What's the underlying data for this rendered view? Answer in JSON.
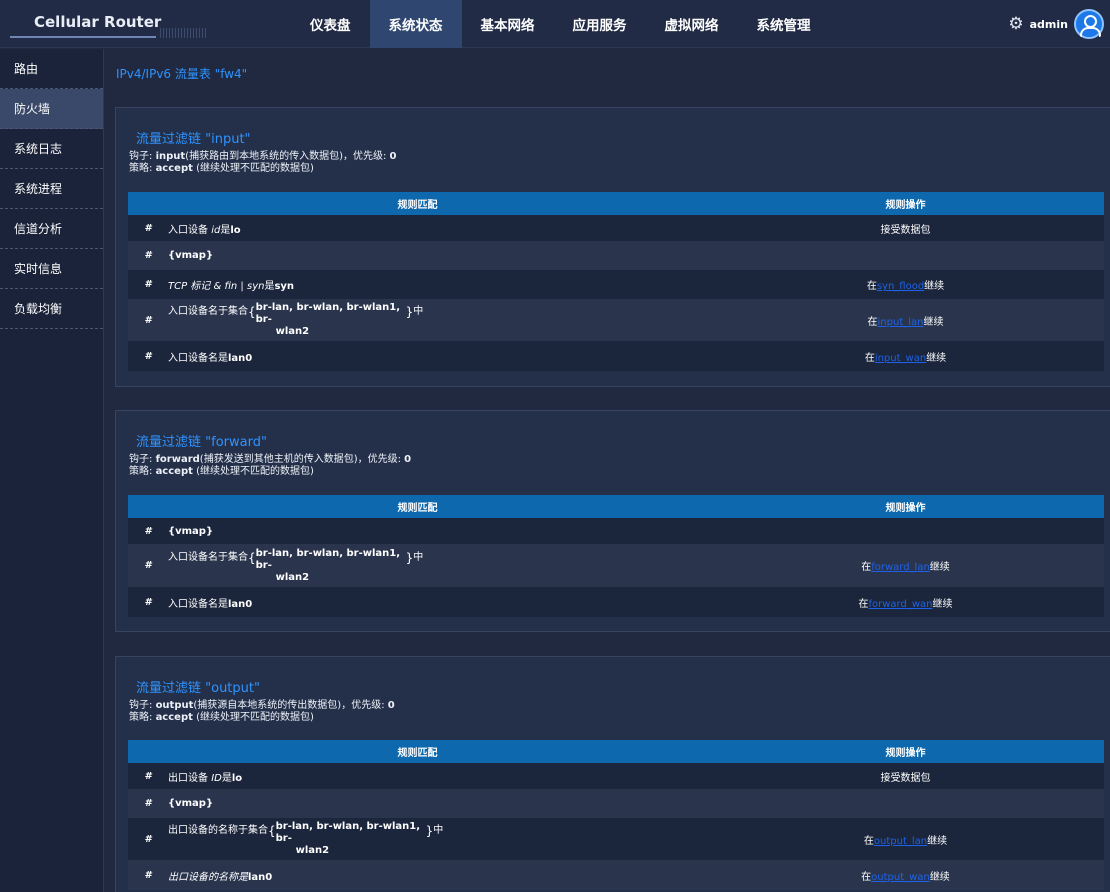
{
  "app": {
    "title": "Cellular Router",
    "user": "admin"
  },
  "nav": [
    "仪表盘",
    "系统状态",
    "基本网络",
    "应用服务",
    "虚拟网络",
    "系统管理"
  ],
  "sidebar": [
    "路由",
    "防火墙",
    "系统日志",
    "系统进程",
    "信道分析",
    "实时信息",
    "负载均衡"
  ],
  "page_title": "IPv4/IPv6 流量表 \"fw4\"",
  "table_headers": {
    "match": "规则匹配",
    "action": "规则操作"
  },
  "chains": [
    {
      "title": "流量过滤链 \"input\"",
      "hook_label": "钩子: ",
      "hook_name": "input",
      "hook_desc": "(捕获路由到本地系统的传入数据包)，优先级: ",
      "priority": "0",
      "policy_label": "策略: ",
      "policy": "accept",
      "policy_desc": " (继续处理不匹配的数据包)",
      "rules": [
        {
          "type": "simple",
          "pre": "入口设备 ",
          "ital": "id",
          "mid": "是",
          "val": "lo",
          "action": "接受数据包"
        },
        {
          "type": "simple",
          "pre": "",
          "ital": "",
          "mid": "",
          "val": "{vmap}",
          "action": ""
        },
        {
          "type": "simple",
          "pre": "TCP 标记 & fin | syn",
          "ital": "",
          "mid": "是",
          "val": "syn",
          "action_pre": "在",
          "action_link": "syn_flood",
          "action_post": "继续"
        },
        {
          "type": "set",
          "pre": "入口设备名于集合",
          "set1": "br-lan, br-wlan, br-wlan1, br-",
          "set2": "wlan2",
          "suffix": "中",
          "action_pre": "在",
          "action_link": "input_lan",
          "action_post": "继续"
        },
        {
          "type": "simple",
          "pre": "入口设备名是",
          "ital": "",
          "mid": "",
          "val": "lan0",
          "action_pre": "在",
          "action_link": "input_wan",
          "action_post": "继续"
        }
      ]
    },
    {
      "title": "流量过滤链 \"forward\"",
      "hook_label": "钩子: ",
      "hook_name": "forward",
      "hook_desc": "(捕获发送到其他主机的传入数据包)，优先级: ",
      "priority": "0",
      "policy_label": "策略: ",
      "policy": "accept",
      "policy_desc": " (继续处理不匹配的数据包)",
      "rules": [
        {
          "type": "simple",
          "pre": "",
          "ital": "",
          "mid": "",
          "val": "{vmap}",
          "action": ""
        },
        {
          "type": "set",
          "pre": "入口设备名于集合",
          "set1": "br-lan, br-wlan, br-wlan1, br-",
          "set2": "wlan2",
          "suffix": "中",
          "action_pre": "在",
          "action_link": "forward_lan",
          "action_post": "继续"
        },
        {
          "type": "simple",
          "pre": "入口设备名是",
          "ital": "",
          "mid": "",
          "val": "lan0",
          "action_pre": "在",
          "action_link": "forward_wan",
          "action_post": "继续"
        }
      ]
    },
    {
      "title": "流量过滤链 \"output\"",
      "hook_label": "钩子: ",
      "hook_name": "output",
      "hook_desc": "(捕获源自本地系统的传出数据包)，优先级: ",
      "priority": "0",
      "policy_label": "策略: ",
      "policy": "accept",
      "policy_desc": " (继续处理不匹配的数据包)",
      "rules": [
        {
          "type": "simple",
          "pre": "出口设备 ",
          "ital": "ID",
          "mid": "是",
          "val": "lo",
          "action": "接受数据包"
        },
        {
          "type": "simple",
          "pre": "",
          "ital": "",
          "mid": "",
          "val": "{vmap}",
          "action": ""
        },
        {
          "type": "set",
          "pre": "出口设备的名称于集合",
          "set1": "br-lan, br-wlan, br-wlan1, br-",
          "set2": "wlan2",
          "suffix": "中",
          "action_pre": "在",
          "action_link": "output_lan",
          "action_post": "继续"
        },
        {
          "type": "simple",
          "pre": "出口设备的名称是",
          "ital": "",
          "mid": "",
          "val": "lan0",
          "action_pre": "在",
          "action_link": "output_wan",
          "action_post": "继续"
        }
      ]
    }
  ]
}
